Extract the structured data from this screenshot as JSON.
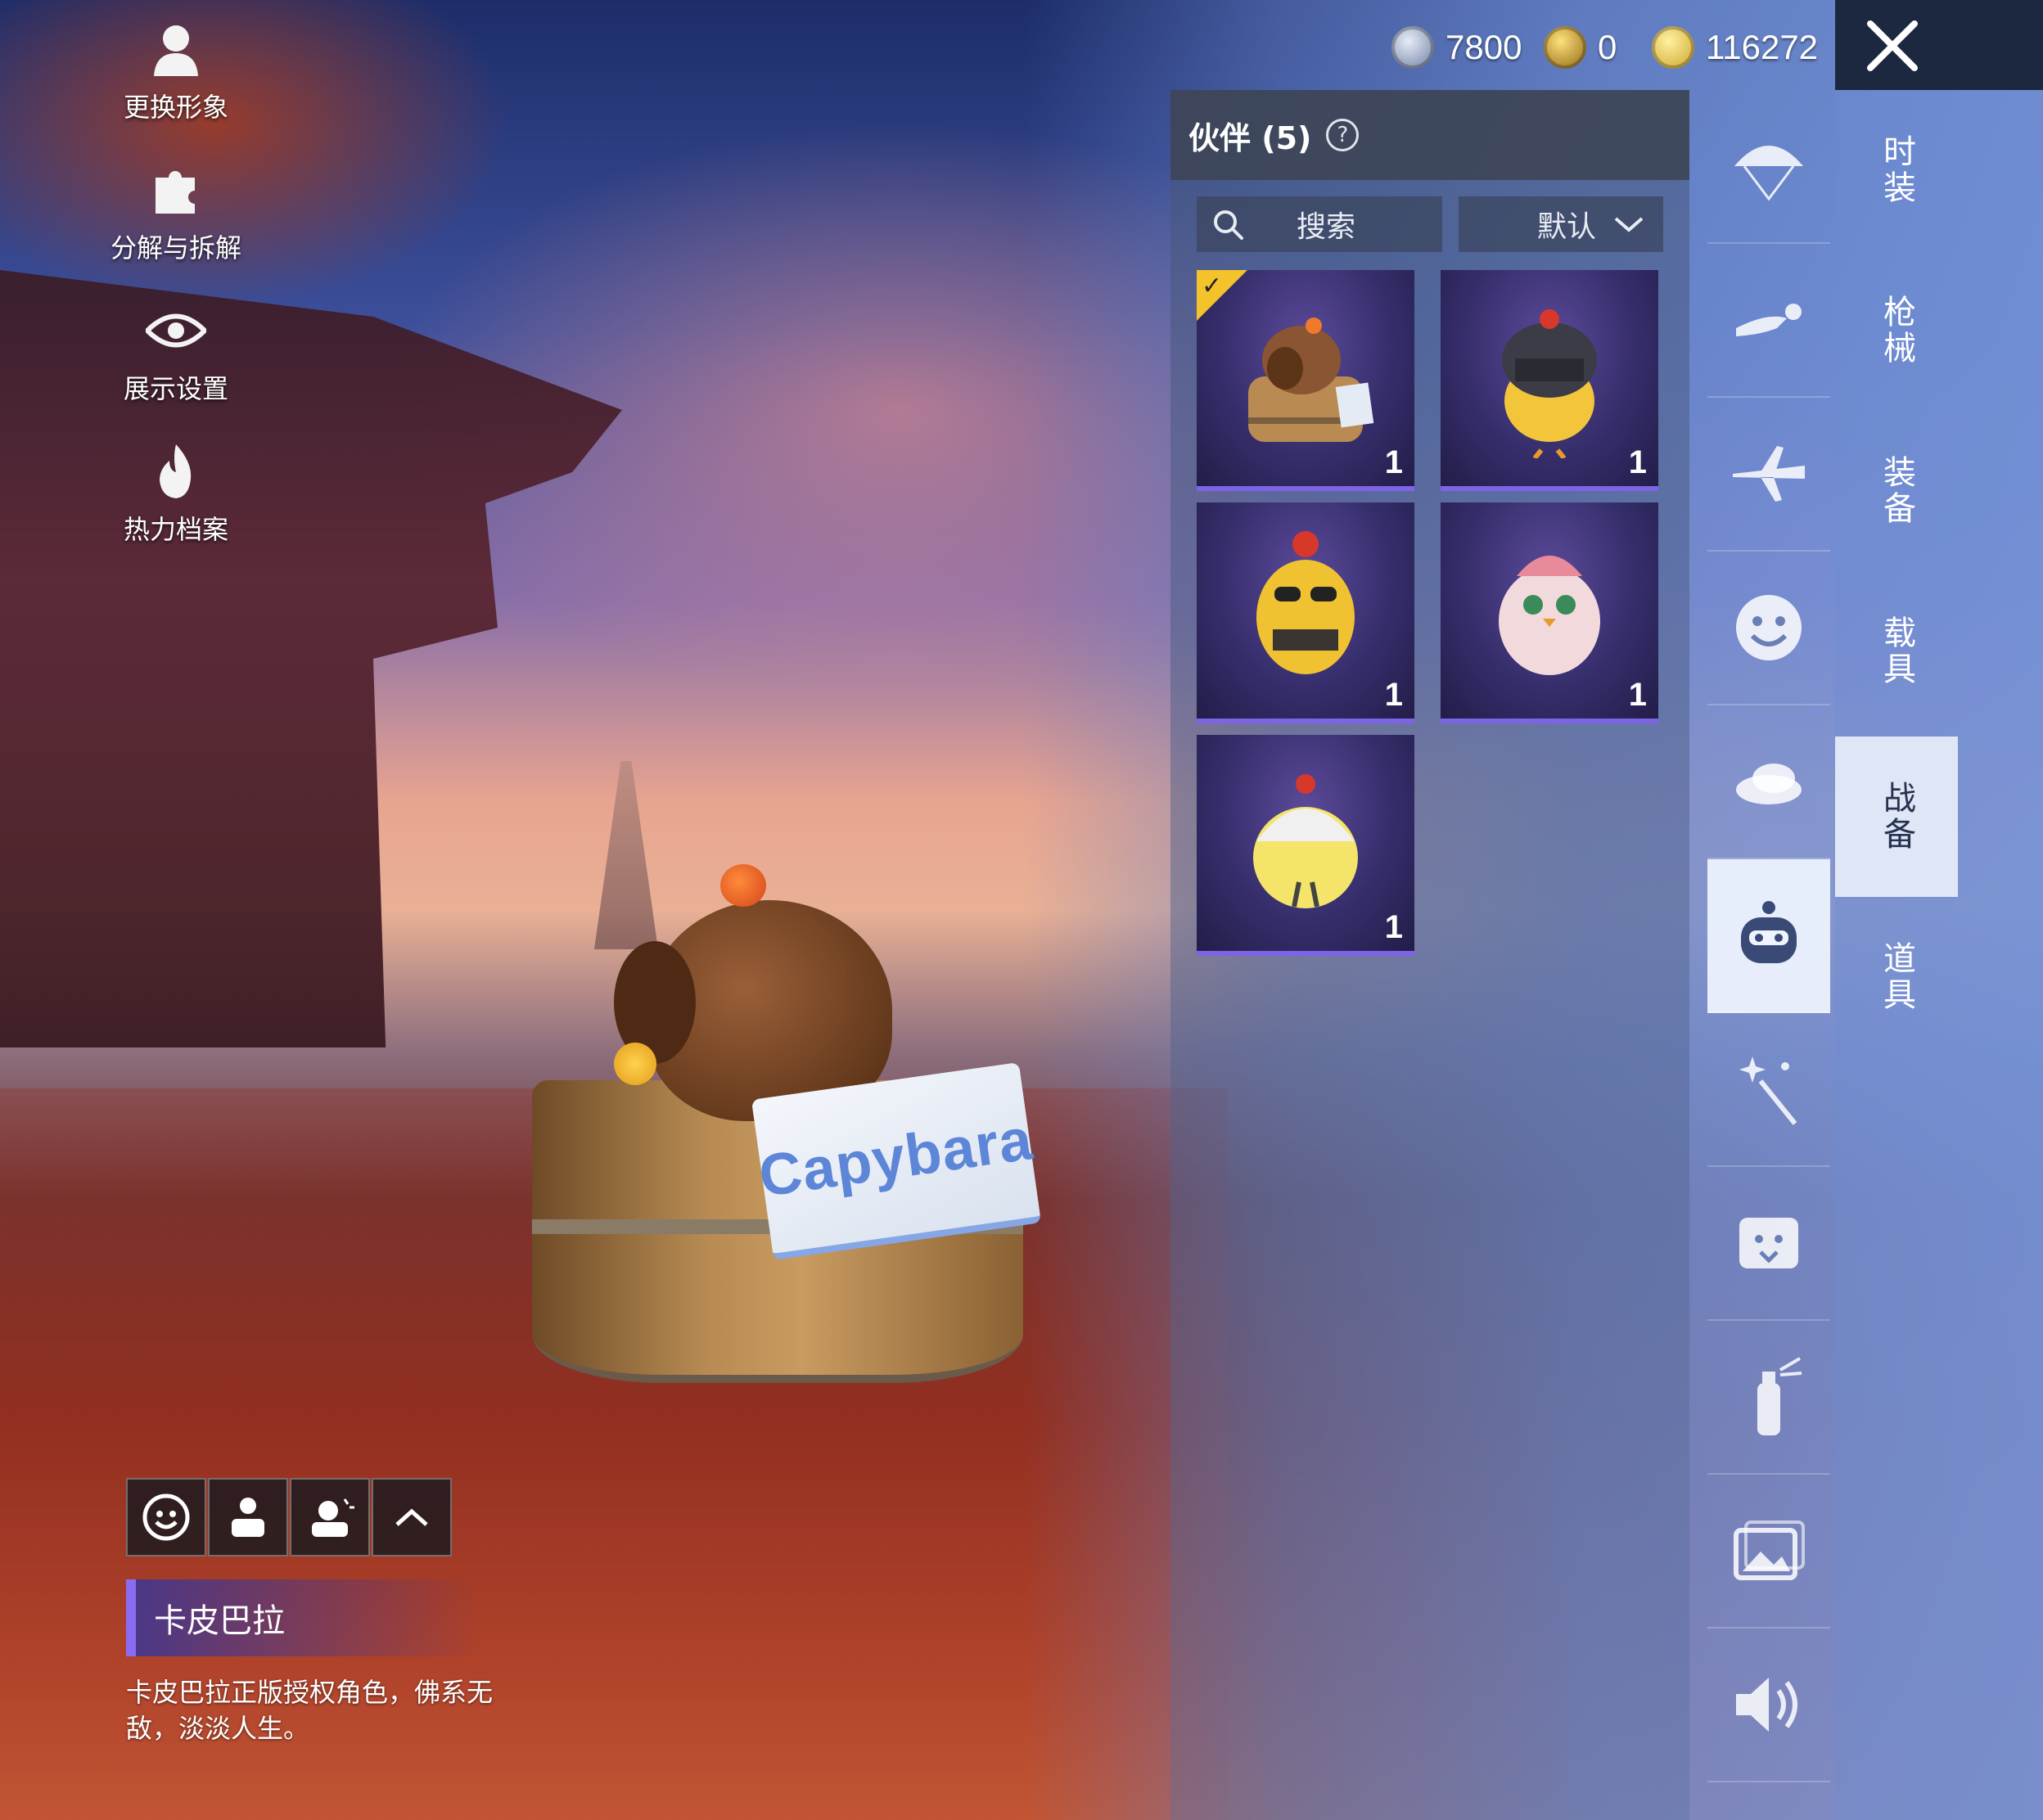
{
  "left_menu": [
    {
      "label": "更换形象",
      "icon": "silhouette-icon"
    },
    {
      "label": "分解与拆解",
      "icon": "puzzle-icon"
    },
    {
      "label": "展示设置",
      "icon": "eye-icon"
    },
    {
      "label": "热力档案",
      "icon": "flame-icon"
    }
  ],
  "currency": {
    "silver": "7800",
    "coupon": "0",
    "gold": "116272"
  },
  "panel": {
    "title": "伙伴 (5)",
    "search_label": "搜索",
    "sort_label": "默认"
  },
  "pets": [
    {
      "name": "capybara-in-tub",
      "count": "1",
      "equipped": true
    },
    {
      "name": "helmet-chick",
      "count": "1",
      "equipped": false
    },
    {
      "name": "sunglasses-chick",
      "count": "1",
      "equipped": false
    },
    {
      "name": "pink-chick",
      "count": "1",
      "equipped": false
    },
    {
      "name": "hat-chick",
      "count": "1",
      "equipped": false
    }
  ],
  "rail_icons": [
    "parachute-icon",
    "skydiver-icon",
    "airplane-icon",
    "emote-face-icon",
    "chicken-icon",
    "companion-icon",
    "sparkle-wand-icon",
    "sticker-icon",
    "spray-icon",
    "gallery-icon",
    "speaker-icon"
  ],
  "tabs": [
    "时装",
    "枪械",
    "装备",
    "载具",
    "战备",
    "道具"
  ],
  "active_tab": "战备",
  "selected_pet": {
    "name": "卡皮巴拉",
    "description": "卡皮巴拉正版授权角色，佛系无敌，淡淡人生。",
    "towel_text": "Capybara"
  },
  "colors": {
    "accent": "#7d63e6",
    "equipped": "#f4c22a",
    "panel_head": "#3c4454"
  }
}
